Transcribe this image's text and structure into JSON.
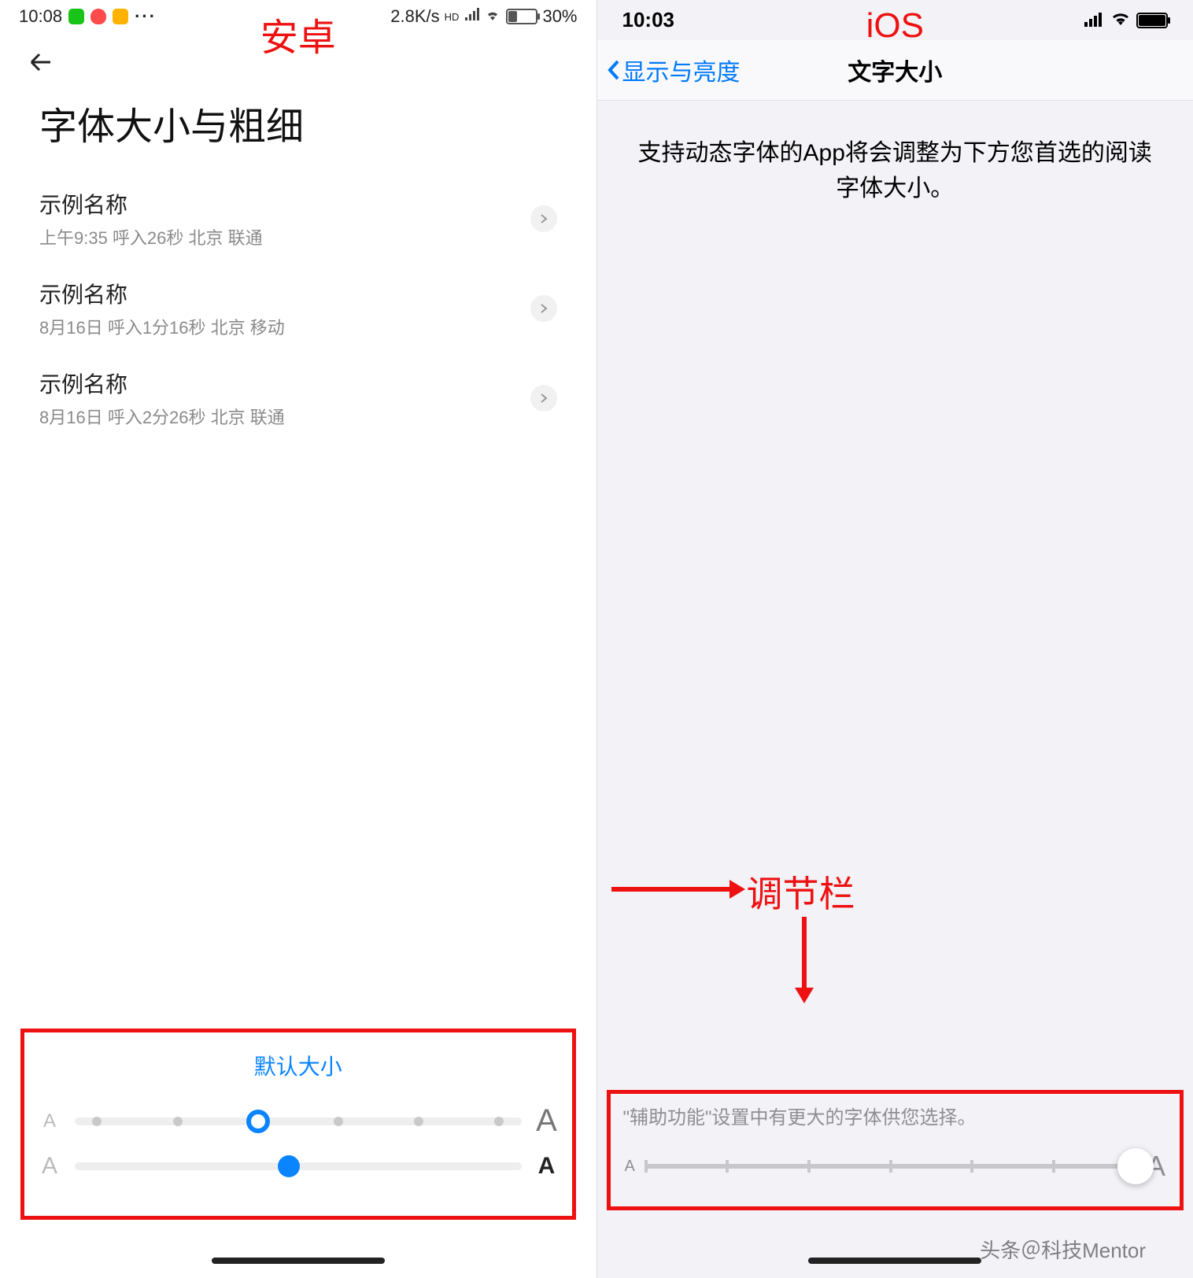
{
  "annotations": {
    "android_label": "安卓",
    "ios_label": "iOS",
    "slider_label": "调节栏",
    "credit": "头条＠科技Mentor"
  },
  "android": {
    "status": {
      "time": "10:08",
      "net_speed": "2.8K/s",
      "hd": "HD",
      "battery_pct": "30%",
      "battery_fill": 30
    },
    "title": "字体大小与粗细",
    "items": [
      {
        "name": "示例名称",
        "detail": "上午9:35 呼入26秒 北京 联通"
      },
      {
        "name": "示例名称",
        "detail": "8月16日 呼入1分16秒 北京 移动"
      },
      {
        "name": "示例名称",
        "detail": "8月16日 呼入2分26秒 北京 联通"
      }
    ],
    "slider": {
      "header": "默认大小",
      "size": {
        "ticks": 6,
        "selected": 2
      },
      "weight": {
        "selected_pct": 48
      }
    }
  },
  "ios": {
    "status": {
      "time": "10:03",
      "battery_fill": 95
    },
    "nav": {
      "back": "显示与亮度",
      "title": "文字大小"
    },
    "description": "支持动态字体的App将会调整为下方您首选的阅读字体大小。",
    "slider": {
      "hint": "\"辅助功能\"设置中有更大的字体供您选择。",
      "ticks": 7,
      "selected": 6
    }
  }
}
